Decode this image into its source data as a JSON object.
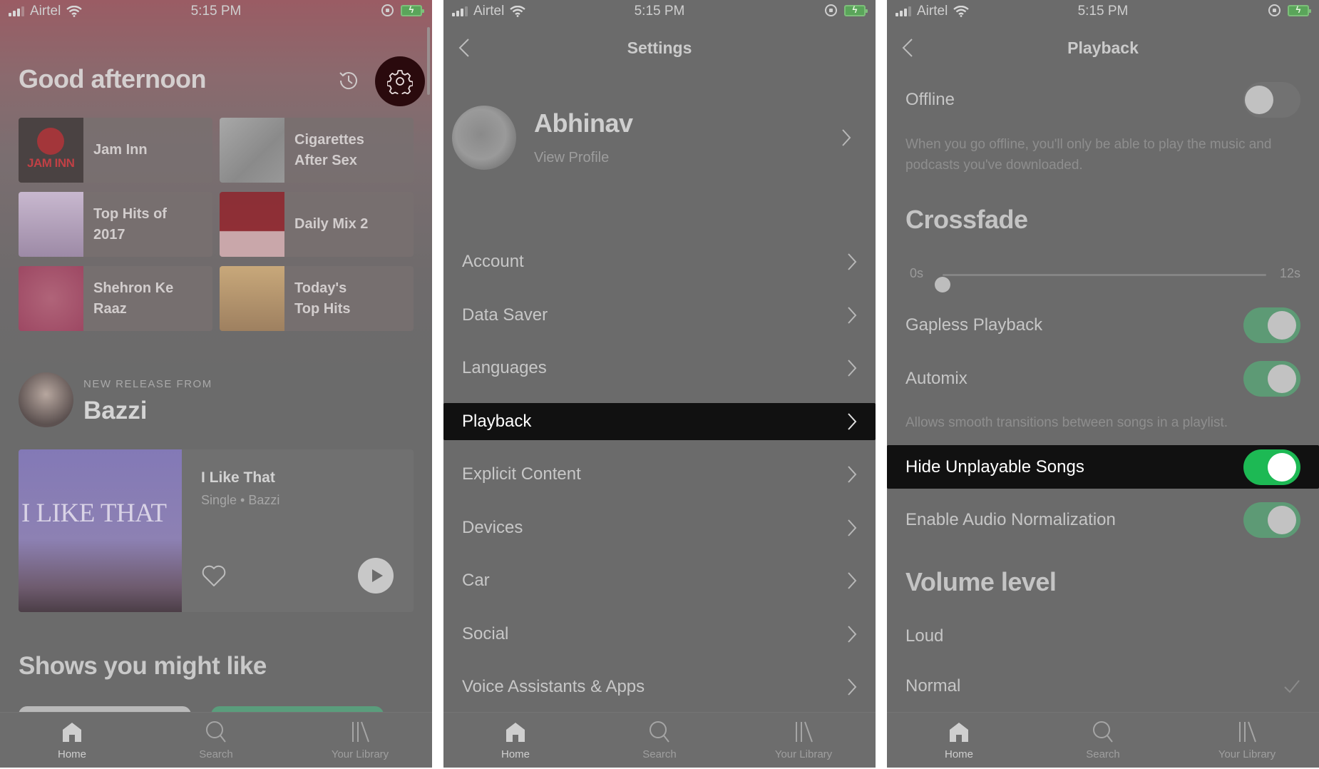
{
  "status_bar": {
    "carrier": "Airtel",
    "time": "5:15 PM",
    "battery": "charging"
  },
  "home": {
    "greeting": "Good afternoon",
    "icons": {
      "history": "history-icon",
      "settings": "gear-icon"
    },
    "shortcuts": [
      {
        "label": "Jam Inn",
        "art": "Jam Inn cover"
      },
      {
        "label": "Cigarettes After Sex",
        "art": "Cigarettes After Sex cover"
      },
      {
        "label": "Top Hits of 2017",
        "art": "Top Hits of 2017 cover"
      },
      {
        "label": "Daily Mix 2",
        "art": "Daily Mix 2 cover"
      },
      {
        "label": "Shehron Ke Raaz",
        "art": "Shehron Ke Raaz cover"
      },
      {
        "label": "Today's Top Hits",
        "art": "Today's Top Hits cover"
      }
    ],
    "new_release": {
      "eyebrow": "NEW RELEASE FROM",
      "artist": "Bazzi",
      "title": "I Like That",
      "subtitle": "Single • Bazzi",
      "art_text": "I LIKE THAT"
    },
    "shows_heading": "Shows you might like"
  },
  "settings": {
    "title": "Settings",
    "profile": {
      "name": "Abhinav",
      "link": "View Profile"
    },
    "items": [
      {
        "label": "Account",
        "selected": false
      },
      {
        "label": "Data Saver",
        "selected": false
      },
      {
        "label": "Languages",
        "selected": false
      },
      {
        "label": "Playback",
        "selected": true
      },
      {
        "label": "Explicit Content",
        "selected": false
      },
      {
        "label": "Devices",
        "selected": false
      },
      {
        "label": "Car",
        "selected": false
      },
      {
        "label": "Social",
        "selected": false
      },
      {
        "label": "Voice Assistants & Apps",
        "selected": false
      }
    ]
  },
  "playback": {
    "title": "Playback",
    "offline": {
      "label": "Offline",
      "on": false,
      "description": "When you go offline, you'll only be able to play the music and podcasts you've downloaded."
    },
    "crossfade": {
      "heading": "Crossfade",
      "min_label": "0s",
      "max_label": "12s",
      "value_seconds": 0,
      "max_seconds": 12
    },
    "gapless": {
      "label": "Gapless Playback",
      "on": true
    },
    "automix": {
      "label": "Automix",
      "on": true,
      "description": "Allows smooth transitions between songs in a playlist."
    },
    "hide_unplayable": {
      "label": "Hide Unplayable Songs",
      "on": true
    },
    "normalization": {
      "label": "Enable Audio Normalization",
      "on": true
    },
    "volume": {
      "heading": "Volume level",
      "options": [
        {
          "label": "Loud",
          "selected": false
        },
        {
          "label": "Normal",
          "selected": true
        }
      ]
    }
  },
  "tabbar": [
    {
      "label": "Home",
      "active": true
    },
    {
      "label": "Search",
      "active": false
    },
    {
      "label": "Your Library",
      "active": false
    }
  ],
  "colors": {
    "accent_green": "#1db954",
    "highlight_bg": "#111111",
    "dim_bg": "#6b6b6b"
  }
}
